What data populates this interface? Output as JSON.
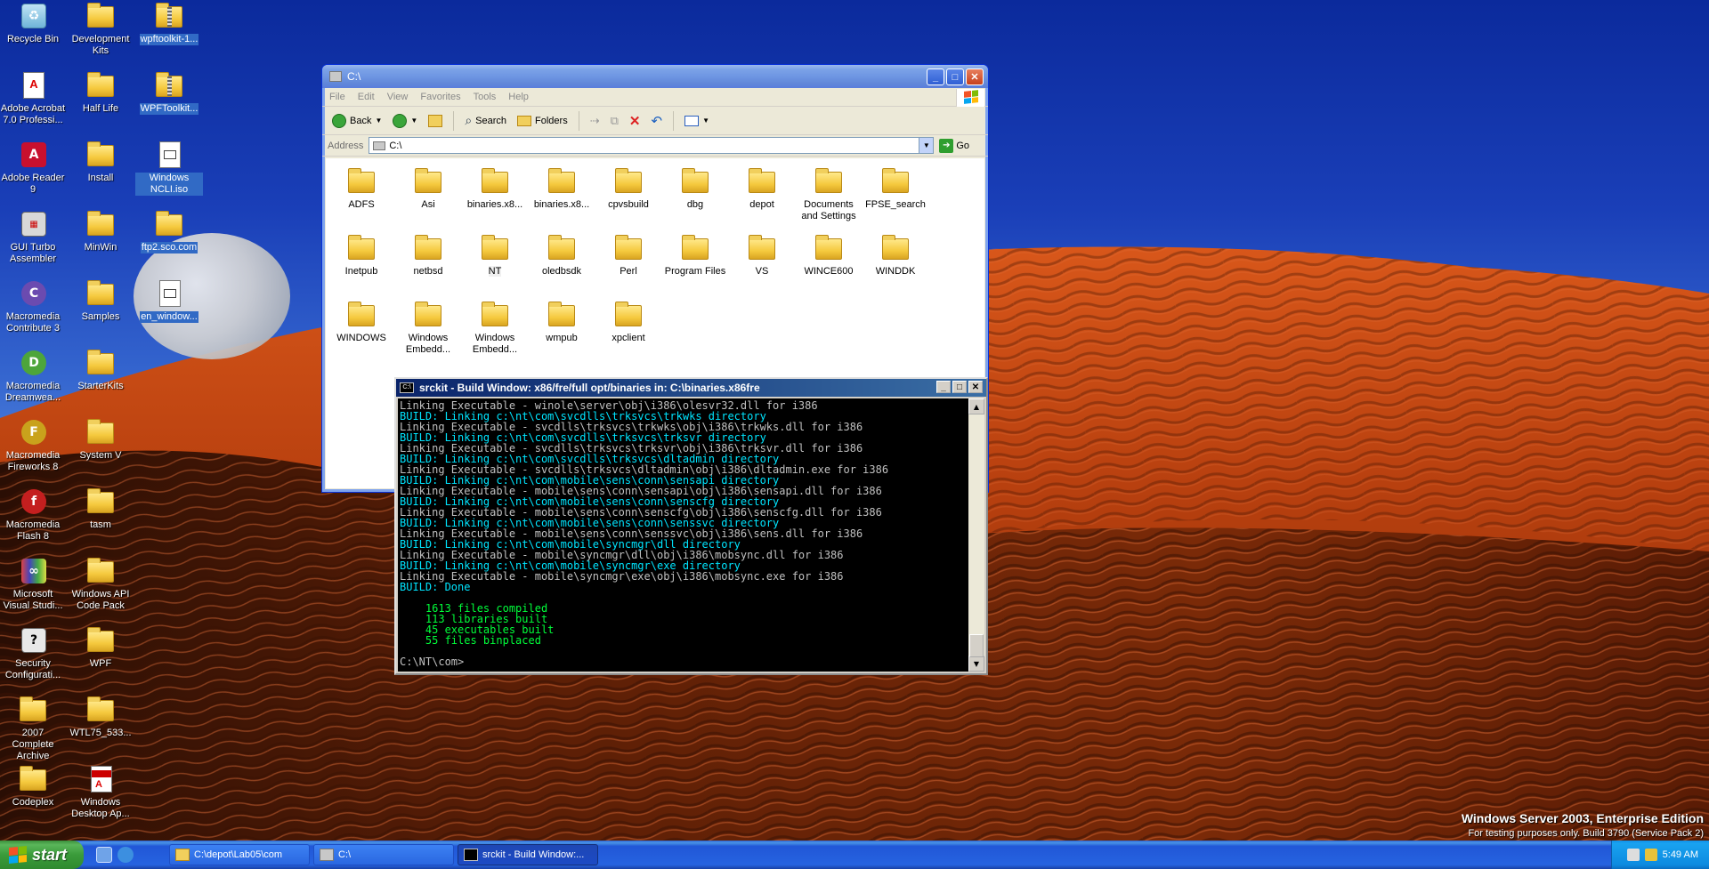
{
  "desktop": {
    "icons_col1": [
      "Recycle Bin",
      "Adobe Acrobat 7.0 Professi...",
      "Adobe Reader 9",
      "GUI Turbo Assembler",
      "Macromedia Contribute 3",
      "Macromedia Dreamwea...",
      "Macromedia Fireworks 8",
      "Macromedia Flash 8",
      "Microsoft Visual Studi...",
      "Security Configurati...",
      "2007 Complete Archive",
      "Codeplex"
    ],
    "icons_col2": [
      "Development Kits",
      "Half Life",
      "Install",
      "MinWin",
      "Samples",
      "StarterKits",
      "System V",
      "tasm",
      "Windows API Code Pack",
      "WPF",
      "WTL75_533...",
      "Windows Desktop Ap..."
    ],
    "icons_col3": [
      "wpftoolkit-1...",
      "WPFToolkit...",
      "Windows NCLI.iso",
      "ftp2.sco.com",
      "en_window..."
    ]
  },
  "explorer": {
    "title": "C:\\",
    "menu": [
      "File",
      "Edit",
      "View",
      "Favorites",
      "Tools",
      "Help"
    ],
    "toolbar": {
      "back": "Back",
      "search": "Search",
      "folders": "Folders"
    },
    "address_label": "Address",
    "address_value": "C:\\",
    "go_label": "Go",
    "items": [
      "ADFS",
      "Asi",
      "binaries.x8...",
      "binaries.x8...",
      "cpvsbuild",
      "dbg",
      "depot",
      "Documents and Settings",
      "FPSE_search",
      "Inetpub",
      "netbsd",
      "NT",
      "oledbsdk",
      "Perl",
      "Program Files",
      "VS",
      "WINCE600",
      "WINDDK",
      "WINDOWS",
      "Windows Embedd...",
      "Windows Embedd...",
      "wmpub",
      "xpclient"
    ]
  },
  "console": {
    "title": "srckit - Build Window: x86/fre/full opt/binaries in: C:\\binaries.x86fre",
    "lines": [
      {
        "t": "Linking Executable - winole\\server\\obj\\i386\\olesvr32.dll for i386",
        "c": "w"
      },
      {
        "t": "BUILD: Linking c:\\nt\\com\\svcdlls\\trksvcs\\trkwks directory",
        "c": "c"
      },
      {
        "t": "Linking Executable - svcdlls\\trksvcs\\trkwks\\obj\\i386\\trkwks.dll for i386",
        "c": "w"
      },
      {
        "t": "BUILD: Linking c:\\nt\\com\\svcdlls\\trksvcs\\trksvr directory",
        "c": "c"
      },
      {
        "t": "Linking Executable - svcdlls\\trksvcs\\trksvr\\obj\\i386\\trksvr.dll for i386",
        "c": "w"
      },
      {
        "t": "BUILD: Linking c:\\nt\\com\\svcdlls\\trksvcs\\dltadmin directory",
        "c": "c"
      },
      {
        "t": "Linking Executable - svcdlls\\trksvcs\\dltadmin\\obj\\i386\\dltadmin.exe for i386",
        "c": "w"
      },
      {
        "t": "BUILD: Linking c:\\nt\\com\\mobile\\sens\\conn\\sensapi directory",
        "c": "c"
      },
      {
        "t": "Linking Executable - mobile\\sens\\conn\\sensapi\\obj\\i386\\sensapi.dll for i386",
        "c": "w"
      },
      {
        "t": "BUILD: Linking c:\\nt\\com\\mobile\\sens\\conn\\senscfg directory",
        "c": "c"
      },
      {
        "t": "Linking Executable - mobile\\sens\\conn\\senscfg\\obj\\i386\\senscfg.dll for i386",
        "c": "w"
      },
      {
        "t": "BUILD: Linking c:\\nt\\com\\mobile\\sens\\conn\\senssvc directory",
        "c": "c"
      },
      {
        "t": "Linking Executable - mobile\\sens\\conn\\senssvc\\obj\\i386\\sens.dll for i386",
        "c": "w"
      },
      {
        "t": "BUILD: Linking c:\\nt\\com\\mobile\\syncmgr\\dll directory",
        "c": "c"
      },
      {
        "t": "Linking Executable - mobile\\syncmgr\\dll\\obj\\i386\\mobsync.dll for i386",
        "c": "w"
      },
      {
        "t": "BUILD: Linking c:\\nt\\com\\mobile\\syncmgr\\exe directory",
        "c": "c"
      },
      {
        "t": "Linking Executable - mobile\\syncmgr\\exe\\obj\\i386\\mobsync.exe for i386",
        "c": "w"
      },
      {
        "t": "BUILD: Done",
        "c": "c"
      },
      {
        "t": "",
        "c": "w"
      },
      {
        "t": "    1613 files compiled",
        "c": "g"
      },
      {
        "t": "    113 libraries built",
        "c": "g"
      },
      {
        "t": "    45 executables built",
        "c": "g"
      },
      {
        "t": "    55 files binplaced",
        "c": "g"
      },
      {
        "t": "",
        "c": "w"
      },
      {
        "t": "C:\\NT\\com>",
        "c": "w"
      }
    ]
  },
  "watermark": {
    "line1": "Windows Server 2003, Enterprise Edition",
    "line2": "For testing purposes only. Build 3790 (Service Pack 2)"
  },
  "taskbar": {
    "start_label": "start",
    "tasks": [
      "C:\\depot\\Lab05\\com",
      "C:\\",
      "srckit - Build Window:..."
    ],
    "clock": "5:49 AM"
  },
  "colors": {
    "console_cyan": "#00e5ff",
    "console_green": "#00ff3a",
    "selection": "#316ac5"
  }
}
